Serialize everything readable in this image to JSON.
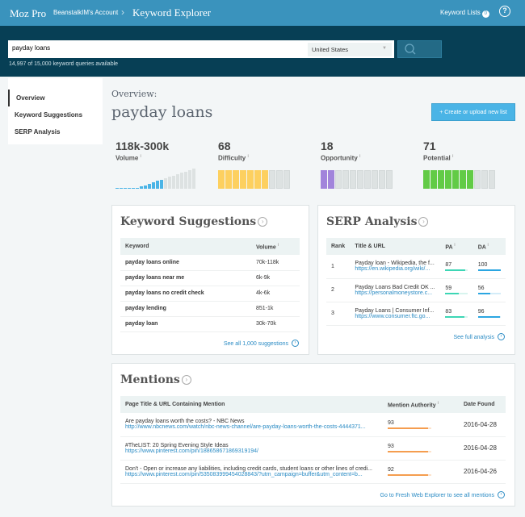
{
  "header": {
    "brand": "Moz Pro",
    "account": "BeanstalkIM's Account",
    "app": "Keyword Explorer",
    "keyword_lists": "Keyword Lists",
    "keyword_lists_count": "0",
    "help": "?"
  },
  "search": {
    "value": "payday loans",
    "country": "United States",
    "quota": "14,997 of 15,000 keyword queries available"
  },
  "sidebar": {
    "items": [
      {
        "label": "Overview"
      },
      {
        "label": "Keyword Suggestions"
      },
      {
        "label": "SERP Analysis"
      }
    ]
  },
  "overview": {
    "label": "Overview:",
    "keyword": "payday loans",
    "create_button": "+ Create or upload new list",
    "metrics": {
      "volume": {
        "value": "118k-300k",
        "label": "Volume"
      },
      "difficulty": {
        "value": "68",
        "label": "Difficulty",
        "filled": 7
      },
      "opportunity": {
        "value": "18",
        "label": "Opportunity",
        "filled": 2
      },
      "potential": {
        "value": "71",
        "label": "Potential",
        "filled": 7
      }
    }
  },
  "colors": {
    "difficulty": "#fdd05f",
    "opportunity": "#a184db",
    "potential": "#62cb46",
    "volume": "#4ab4e6"
  },
  "suggestions": {
    "title": "Keyword Suggestions",
    "col_keyword": "Keyword",
    "col_volume": "Volume",
    "rows": [
      {
        "keyword": "payday loans online",
        "volume": "70k-118k"
      },
      {
        "keyword": "payday loans near me",
        "volume": "6k-9k"
      },
      {
        "keyword": "payday loans no credit check",
        "volume": "4k-6k"
      },
      {
        "keyword": "payday lending",
        "volume": "851-1k"
      },
      {
        "keyword": "payday loan",
        "volume": "30k-70k"
      }
    ],
    "see_all": "See all 1,000 suggestions"
  },
  "serp": {
    "title": "SERP Analysis",
    "col_rank": "Rank",
    "col_title": "Title & URL",
    "col_pa": "PA",
    "col_da": "DA",
    "rows": [
      {
        "rank": "1",
        "title": "Payday loan - Wikipedia, the f...",
        "url": "https://en.wikipedia.org/wiki/...",
        "pa": "87",
        "da": "100"
      },
      {
        "rank": "2",
        "title": "Payday Loans Bad Credit OK ...",
        "url": "https://personalmoneystore.c...",
        "pa": "59",
        "da": "56"
      },
      {
        "rank": "3",
        "title": "Payday Loans | Consumer Inf...",
        "url": "https://www.consumer.ftc.go...",
        "pa": "83",
        "da": "96"
      }
    ],
    "see_full": "See full analysis"
  },
  "mentions": {
    "title": "Mentions",
    "col_page": "Page Title & URL Containing Mention",
    "col_authority": "Mention Authority",
    "col_date": "Date Found",
    "rows": [
      {
        "title": "Are payday loans worth the costs? - NBC News",
        "url": "http://www.nbcnews.com/watch/nbc-news-channel/are-payday-loans-worth-the-costs-4444371...",
        "authority": "93",
        "date": "2016-04-28"
      },
      {
        "title": "#TheLIST: 20 Spring Evening Style Ideas",
        "url": "https://www.pinterest.com/pin/188658671869319194/",
        "authority": "93",
        "date": "2016-04-28"
      },
      {
        "title": "Don't - Open or increase any liabilities, including credit cards, student loans or other lines of credi...",
        "url": "https://www.pinterest.com/pin/535083999454028843/?utm_campaign=buffer&utm_content=b...",
        "authority": "92",
        "date": "2016-04-26"
      }
    ],
    "see_all": "Go to Fresh Web Explorer to see all mentions"
  }
}
